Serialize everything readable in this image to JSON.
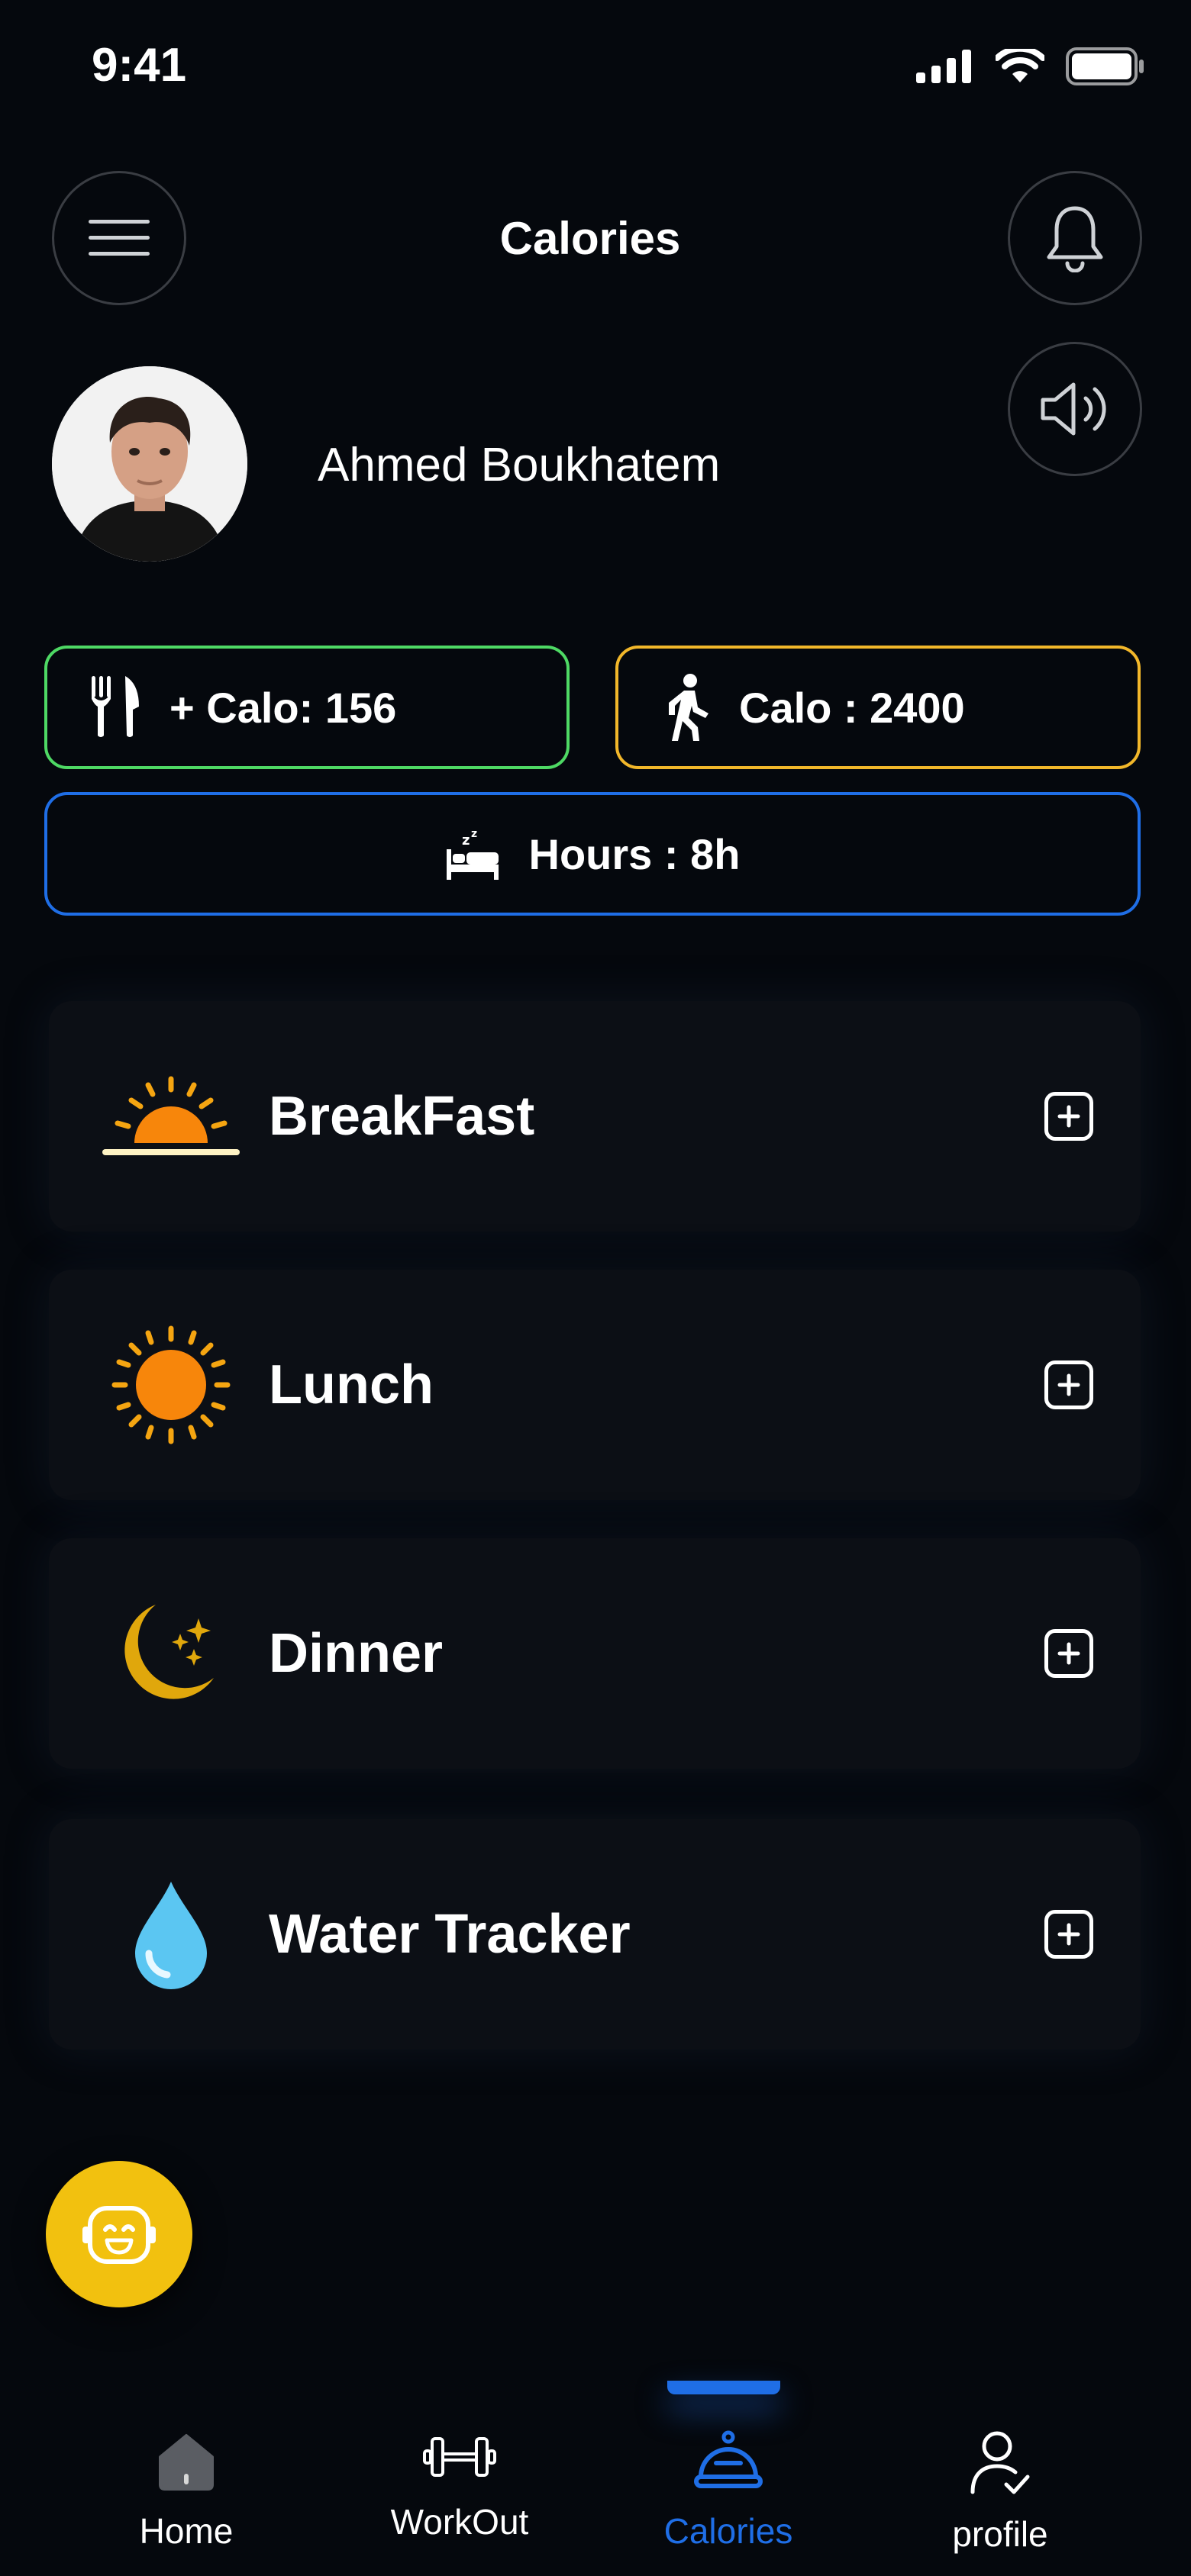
{
  "status_bar": {
    "time": "9:41"
  },
  "header": {
    "title": "Calories"
  },
  "user": {
    "name": "Ahmed Boukhatem"
  },
  "stats": {
    "calo_in": "+ Calo: 156",
    "calo_out": "Calo : 2400",
    "hours": "Hours : 8h"
  },
  "meals": [
    {
      "label": "BreakFast",
      "icon": "sunrise-icon"
    },
    {
      "label": "Lunch",
      "icon": "sun-icon"
    },
    {
      "label": "Dinner",
      "icon": "moon-icon"
    },
    {
      "label": "Water Tracker",
      "icon": "water-drop-icon"
    }
  ],
  "nav": {
    "items": [
      {
        "label": "Home",
        "icon": "home-icon"
      },
      {
        "label": "WorkOut",
        "icon": "dumbbell-icon"
      },
      {
        "label": "Calories",
        "icon": "food-cover-icon"
      },
      {
        "label": "profile",
        "icon": "profile-icon"
      }
    ],
    "active": "Calories"
  },
  "colors": {
    "background": "#05080d",
    "card": "#0c0f15",
    "calo_in_border": "#4ed964",
    "calo_out_border": "#f2b72a",
    "hours_border": "#1f6ee6",
    "accent": "#1f6ee6",
    "assistant": "#f2c10f"
  }
}
